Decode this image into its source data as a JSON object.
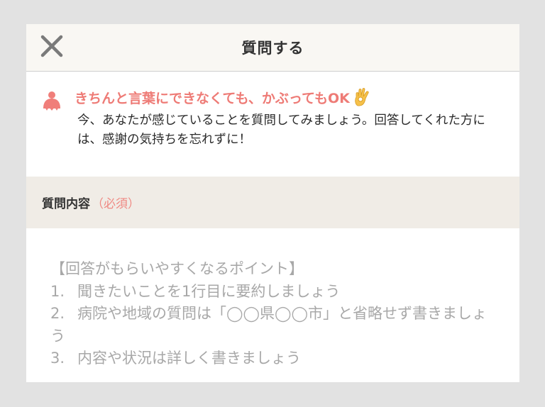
{
  "header": {
    "title": "質問する",
    "close_icon": "close-icon"
  },
  "tip": {
    "icon": "person-silhouette-icon",
    "headline": "きちんと言葉にできなくても、かぶってもOK",
    "headline_emoji_icon": "ok-hand-icon",
    "body": "今、あなたが感じていることを質問してみましょう。回答してくれた方には、感謝の気持ちを忘れずに！",
    "accent_color": "#ee7b76"
  },
  "section": {
    "title": "質問内容",
    "required_label": "（必須）"
  },
  "question_input": {
    "placeholder_heading": "【回答がもらいやすくなるポイント】",
    "points": [
      {
        "number": "1.",
        "text": "聞きたいことを1行目に要約しましょう"
      },
      {
        "number": "2.",
        "text": "病院や地域の質問は「◯◯県◯◯市」と省略せず書きましょう"
      },
      {
        "number": "3.",
        "text": "内容や状況は詳しく書きましょう"
      }
    ]
  }
}
